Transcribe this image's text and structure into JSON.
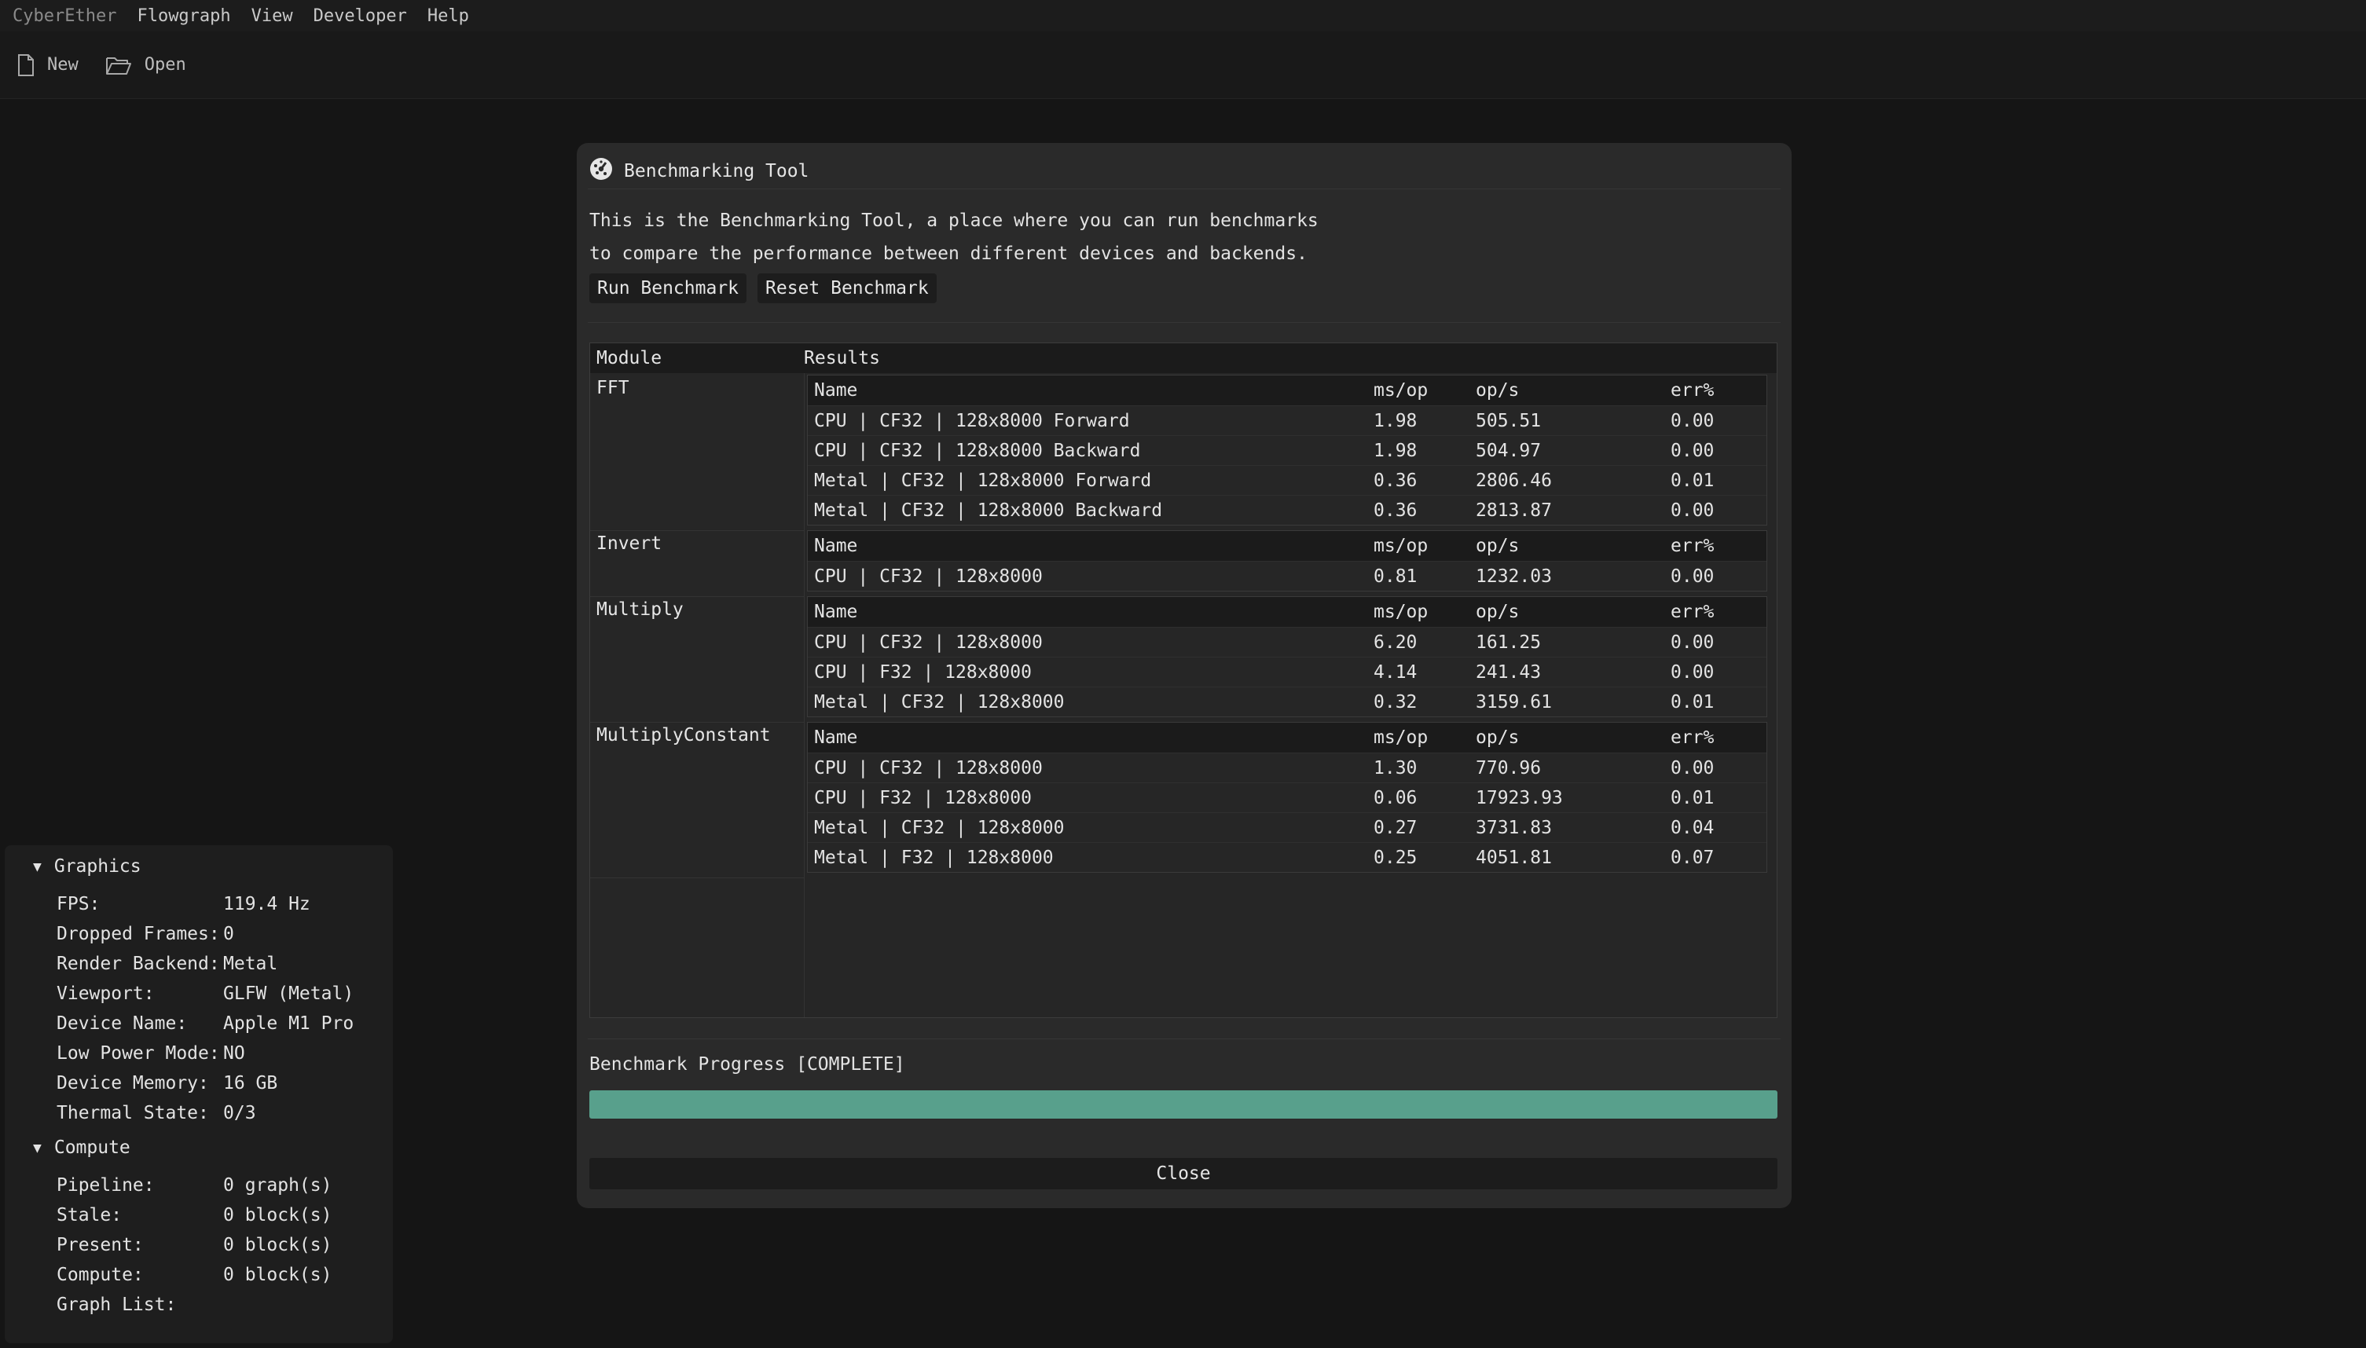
{
  "menubar": {
    "app_name": "CyberEther",
    "items": [
      "Flowgraph",
      "View",
      "Developer",
      "Help"
    ]
  },
  "toolbar": {
    "new_label": "New",
    "open_label": "Open"
  },
  "dialog": {
    "title": "Benchmarking Tool",
    "description_lines": [
      "This is the Benchmarking Tool, a place where you can run benchmarks",
      "to compare the performance between different devices and backends."
    ],
    "run_label": "Run Benchmark",
    "reset_label": "Reset Benchmark",
    "table": {
      "module_header": "Module",
      "results_header": "Results",
      "sub_headers": [
        "Name",
        "ms/op",
        "op/s",
        "err%"
      ],
      "modules": [
        {
          "name": "FFT",
          "rows": [
            [
              "CPU | CF32 | 128x8000 Forward",
              "1.98",
              "505.51",
              "0.00"
            ],
            [
              "CPU | CF32 | 128x8000 Backward",
              "1.98",
              "504.97",
              "0.00"
            ],
            [
              "Metal | CF32 | 128x8000 Forward",
              "0.36",
              "2806.46",
              "0.01"
            ],
            [
              "Metal | CF32 | 128x8000 Backward",
              "0.36",
              "2813.87",
              "0.00"
            ]
          ]
        },
        {
          "name": "Invert",
          "rows": [
            [
              "CPU | CF32 | 128x8000",
              "0.81",
              "1232.03",
              "0.00"
            ]
          ]
        },
        {
          "name": "Multiply",
          "rows": [
            [
              "CPU | CF32 | 128x8000",
              "6.20",
              "161.25",
              "0.00"
            ],
            [
              "CPU | F32 | 128x8000",
              "4.14",
              "241.43",
              "0.00"
            ],
            [
              "Metal | CF32 | 128x8000",
              "0.32",
              "3159.61",
              "0.01"
            ]
          ]
        },
        {
          "name": "MultiplyConstant",
          "rows": [
            [
              "CPU | CF32 | 128x8000",
              "1.30",
              "770.96",
              "0.00"
            ],
            [
              "CPU | F32 | 128x8000",
              "0.06",
              "17923.93",
              "0.01"
            ],
            [
              "Metal | CF32 | 128x8000",
              "0.27",
              "3731.83",
              "0.04"
            ],
            [
              "Metal | F32 | 128x8000",
              "0.25",
              "4051.81",
              "0.07"
            ]
          ]
        }
      ]
    },
    "progress_label": "Benchmark Progress [COMPLETE]",
    "progress_fraction": 1.0,
    "close_label": "Close",
    "accent_color": "#58a08c"
  },
  "stats": {
    "graphics": {
      "title": "Graphics",
      "items": [
        {
          "k": "FPS:",
          "v": "119.4 Hz"
        },
        {
          "k": "Dropped Frames:",
          "v": "0"
        },
        {
          "k": "Render Backend:",
          "v": "Metal"
        },
        {
          "k": "Viewport:",
          "v": "GLFW (Metal)"
        },
        {
          "k": "Device Name:",
          "v": "Apple M1 Pro"
        },
        {
          "k": "Low Power Mode:",
          "v": "NO"
        },
        {
          "k": "Device Memory:",
          "v": "16 GB"
        },
        {
          "k": "Thermal State:",
          "v": "0/3"
        }
      ]
    },
    "compute": {
      "title": "Compute",
      "items": [
        {
          "k": "Pipeline:",
          "v": "0 graph(s)"
        },
        {
          "k": "Stale:",
          "v": "0 block(s)"
        },
        {
          "k": "Present:",
          "v": "0 block(s)"
        },
        {
          "k": "Compute:",
          "v": "0 block(s)"
        },
        {
          "k": "Graph List:",
          "v": ""
        }
      ]
    }
  }
}
